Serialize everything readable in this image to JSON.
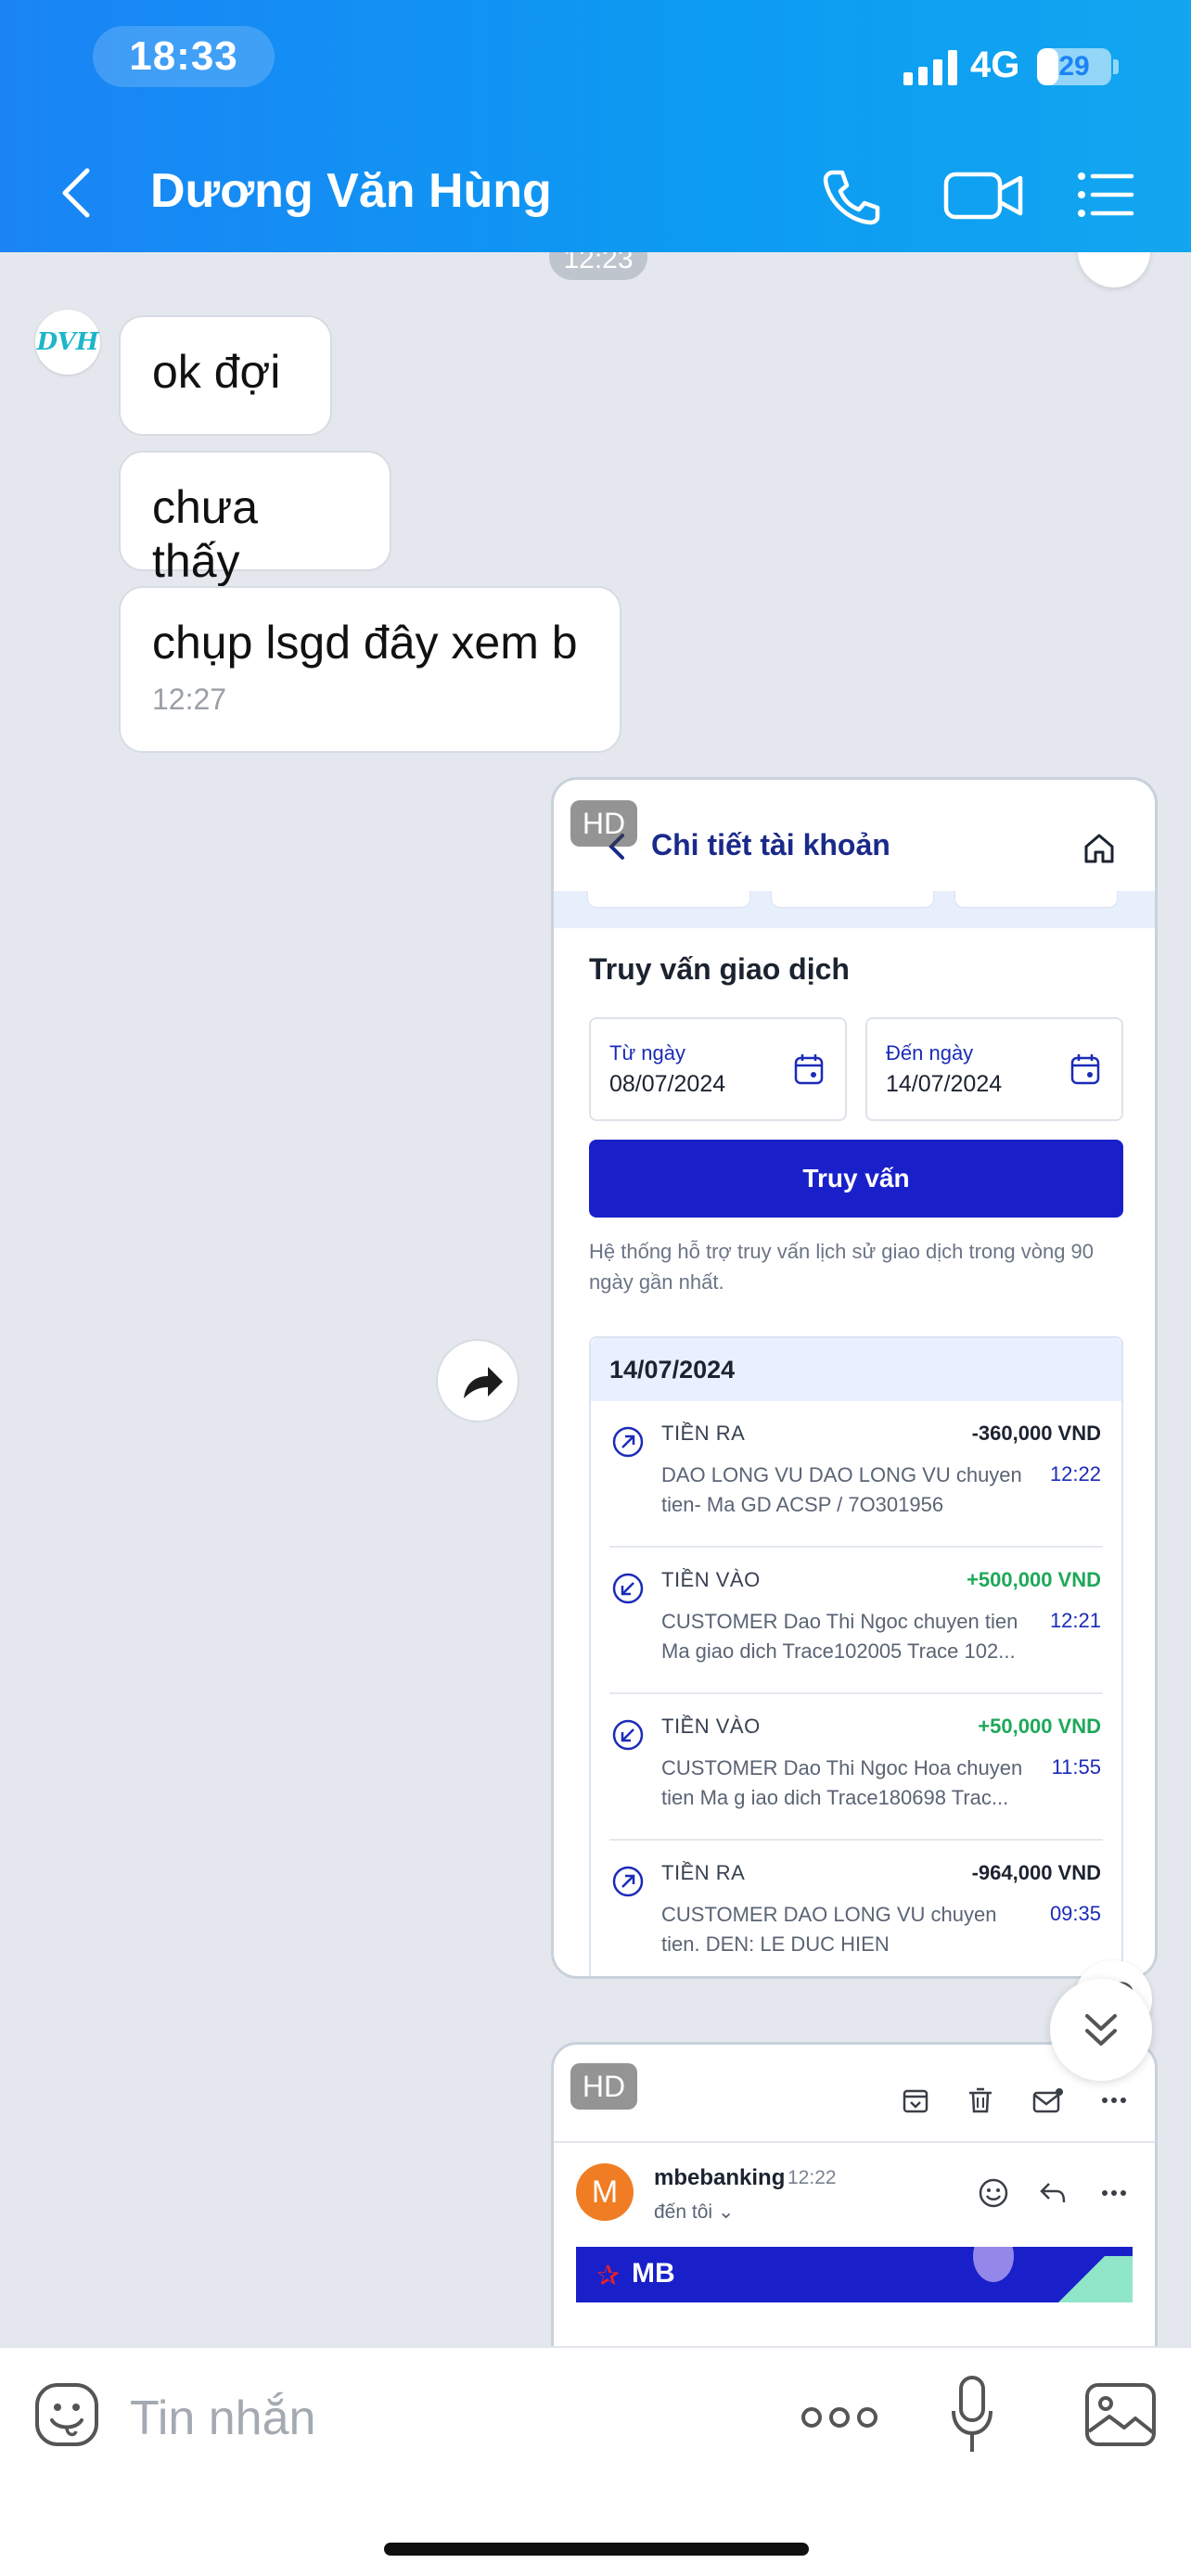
{
  "status_bar": {
    "time": "18:33",
    "network": "4G",
    "battery": "29",
    "battery_level": 0.29
  },
  "header": {
    "contact_name": "Dương Văn Hùng"
  },
  "chat": {
    "time_separator": "12:23",
    "avatar_text": "DVH",
    "messages": [
      {
        "text": "ok đợi"
      },
      {
        "text": "chưa thấy"
      },
      {
        "text": "chụp lsgd đây xem b",
        "time": "12:27"
      }
    ],
    "image_badge": "HD",
    "bank_screenshot": {
      "title": "Chi tiết tài khoản",
      "section_title": "Truy vấn giao dịch",
      "from_label": "Từ ngày",
      "from_value": "08/07/2024",
      "to_label": "Đến ngày",
      "to_value": "14/07/2024",
      "query_button": "Truy vấn",
      "note": "Hệ thống hỗ trợ truy vấn lịch sử giao dịch trong vòng 90 ngày gần nhất.",
      "date_header": "14/07/2024",
      "transactions": [
        {
          "type": "TIỀN RA",
          "direction": "out",
          "amount": "-360,000 VND",
          "time": "12:22",
          "desc_line1": "DAO LONG VU DAO LONG VU chuyen",
          "desc_line2": "tien- Ma GD ACSP / 7O301956"
        },
        {
          "type": "TIỀN VÀO",
          "direction": "in",
          "amount": "+500,000 VND",
          "time": "12:21",
          "desc_line1": "CUSTOMER Dao Thi Ngoc chuyen tien",
          "desc_line2": "Ma giao  dich  Trace102005 Trace 102..."
        },
        {
          "type": "TIỀN VÀO",
          "direction": "in",
          "amount": "+50,000 VND",
          "time": "11:55",
          "desc_line1": "CUSTOMER Dao Thi Ngoc Hoa chuyen",
          "desc_line2": "tien   Ma g iao dich  Trace180698 Trac..."
        },
        {
          "type": "TIỀN RA",
          "direction": "out",
          "amount": "-964,000 VND",
          "time": "09:35",
          "desc_line1": "CUSTOMER DAO LONG VU chuyen",
          "desc_line2": "tien. DEN: LE DUC HIEN"
        }
      ]
    },
    "email_screenshot": {
      "avatar_letter": "M",
      "sender": "mbebanking",
      "time": "12:22",
      "to": "đến tôi ⌄",
      "banner_logo": "MB"
    }
  },
  "input_bar": {
    "placeholder": "Tin nhắn"
  },
  "colors": {
    "header_blue": "#1a84f5",
    "mb_blue": "#1a20c9",
    "positive": "#1ea85a"
  }
}
